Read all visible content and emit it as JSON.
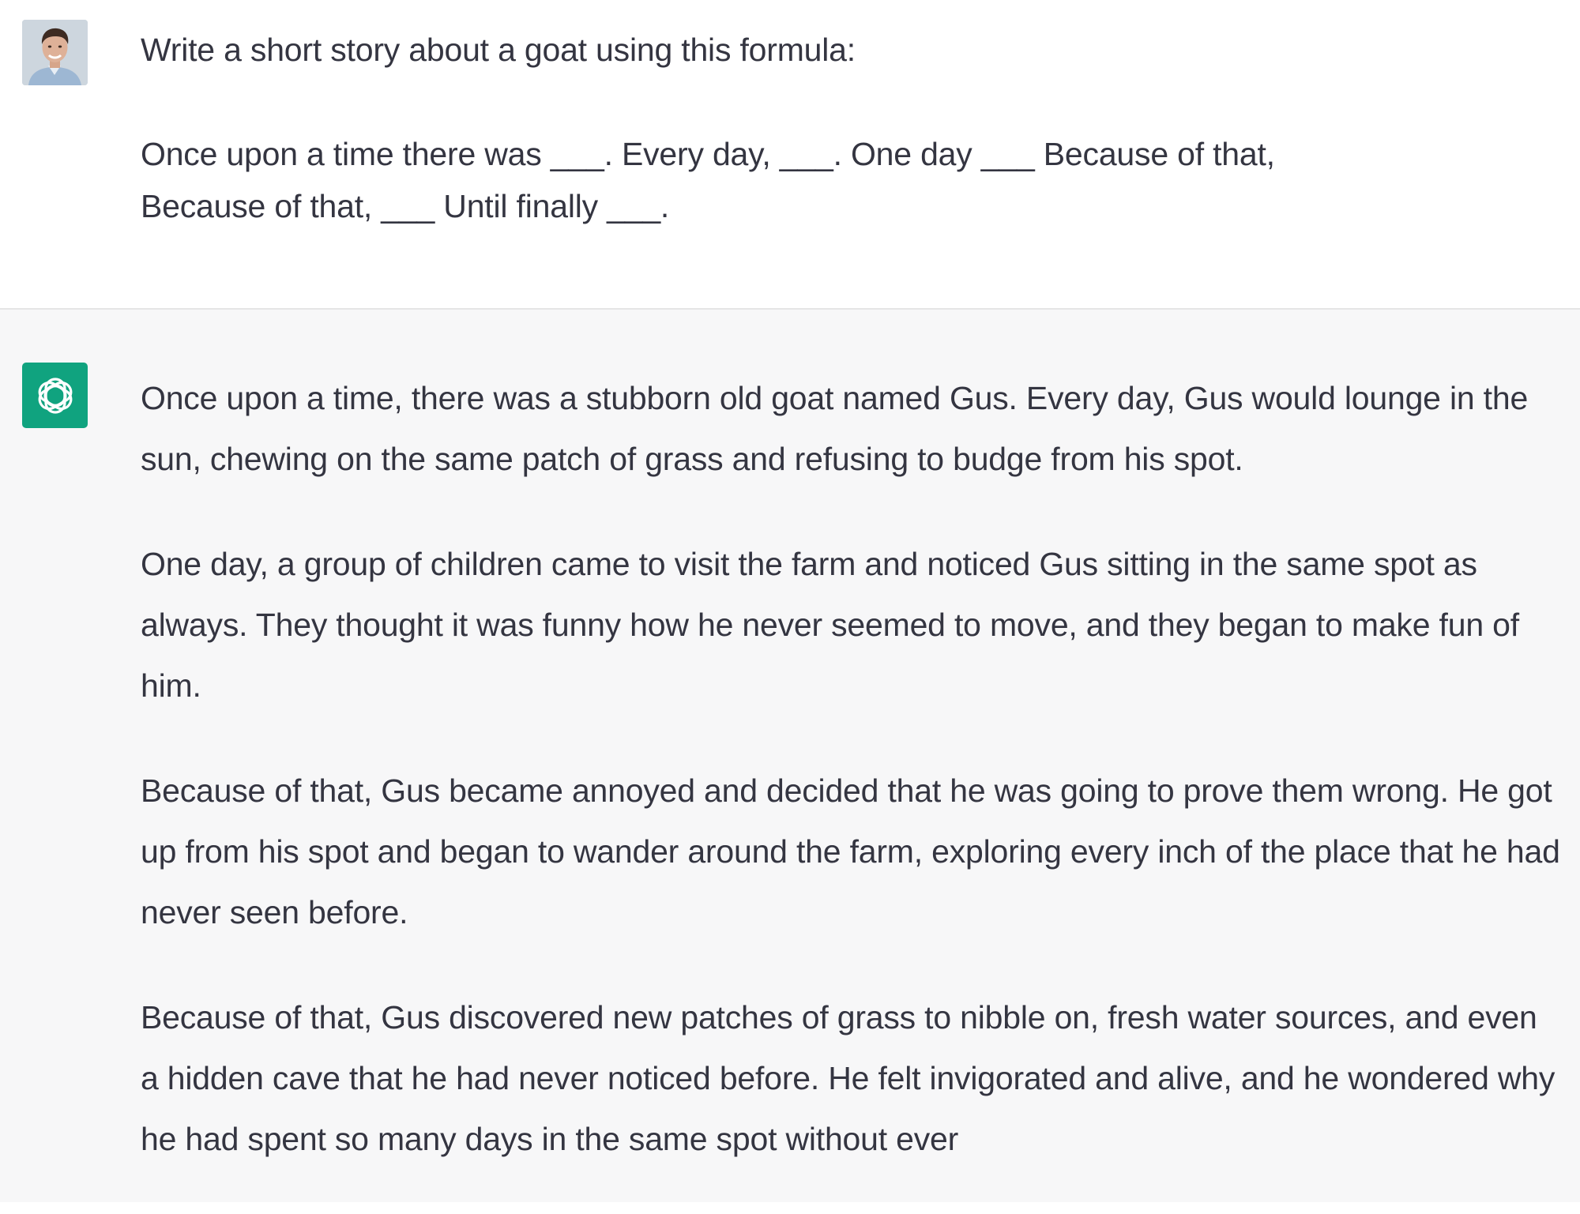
{
  "user_turn": {
    "avatar_icon": "user-avatar-photo",
    "line1": "Write a short story about a goat using this formula:",
    "line2": "Once upon a time there was ___. Every day, ___. One day ___ Because of that,",
    "line3": "Because of that, ___ Until finally ___."
  },
  "assistant_turn": {
    "avatar_icon": "chatgpt-logo-icon",
    "avatar_color": "#10a37f",
    "paragraphs": [
      "Once upon a time, there was a stubborn old goat named Gus. Every day, Gus would lounge in the sun, chewing on the same patch of grass and refusing to budge from his spot.",
      "One day, a group of children came to visit the farm and noticed Gus sitting in the same spot as always. They thought it was funny how he never seemed to move, and they began to make fun of him.",
      "Because of that, Gus became annoyed and decided that he was going to prove them wrong. He got up from his spot and began to wander around the farm, exploring every inch of the place that he had never seen before.",
      "Because of that, Gus discovered new patches of grass to nibble on, fresh water sources, and even a hidden cave that he had never noticed before. He felt invigorated and alive, and he wondered why he had spent so many days in the same spot without ever"
    ]
  }
}
